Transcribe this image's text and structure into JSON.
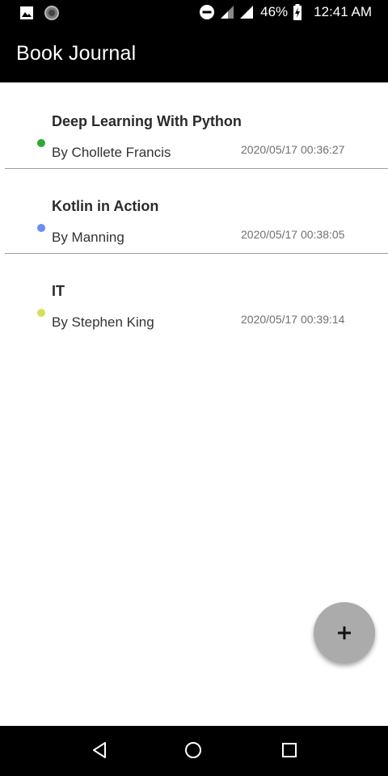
{
  "status_bar": {
    "battery_percent": "46%",
    "time": "12:41 AM",
    "icons": [
      "gallery-icon",
      "app-icon",
      "dnd-icon",
      "signal-icon",
      "signal-icon",
      "battery-charging-icon"
    ]
  },
  "app_bar": {
    "title": "Book Journal"
  },
  "books": [
    {
      "title": "Deep Learning With Python",
      "author": "By Chollete Francis",
      "date": "2020/05/17 00:36:27",
      "color": "#2ea836"
    },
    {
      "title": "Kotlin in Action",
      "author": "By Manning",
      "date": "2020/05/17 00:38:05",
      "color": "#6b8cf0"
    },
    {
      "title": "IT",
      "author": "By Stephen King",
      "date": "2020/05/17 00:39:14",
      "color": "#d4e157"
    }
  ],
  "fab": {
    "icon": "plus-icon"
  },
  "nav_bar": {
    "icons": [
      "back-icon",
      "home-icon",
      "recents-icon"
    ]
  }
}
